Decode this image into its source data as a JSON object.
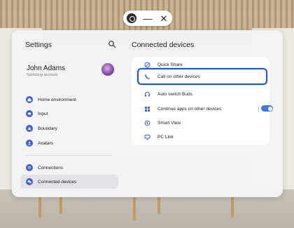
{
  "window_controls": {
    "minimize_glyph": "—",
    "close_glyph": "✕"
  },
  "sidebar": {
    "title": "Settings",
    "profile": {
      "name": "John Adams",
      "subtitle": "Samsung account"
    },
    "items": [
      {
        "label": "Home environment",
        "icon": "home-icon"
      },
      {
        "label": "Input",
        "icon": "input-icon"
      },
      {
        "label": "Boundary",
        "icon": "boundary-icon"
      },
      {
        "label": "Avatars",
        "icon": "avatar-icon"
      },
      {
        "label": "Connections",
        "icon": "wifi-icon"
      },
      {
        "label": "Connected devices",
        "icon": "connected-devices-icon",
        "active": true
      }
    ]
  },
  "main": {
    "title": "Connected devices",
    "rows": [
      {
        "label": "Quick Share",
        "icon": "quick-share-icon"
      },
      {
        "label": "Call on other devices",
        "icon": "call-icon",
        "highlighted": true
      },
      {
        "label": "Auto switch Buds",
        "icon": "buds-icon"
      },
      {
        "label": "Continue apps on other devices",
        "icon": "continue-apps-icon",
        "toggle": true
      },
      {
        "label": "Smart View",
        "icon": "smart-view-icon"
      },
      {
        "label": "PC Link",
        "icon": "pc-link-icon"
      }
    ]
  },
  "colors": {
    "accent": "#3e5fd6",
    "highlight_border": "#1a5bc4",
    "toggle_on": "#3e7be8"
  }
}
